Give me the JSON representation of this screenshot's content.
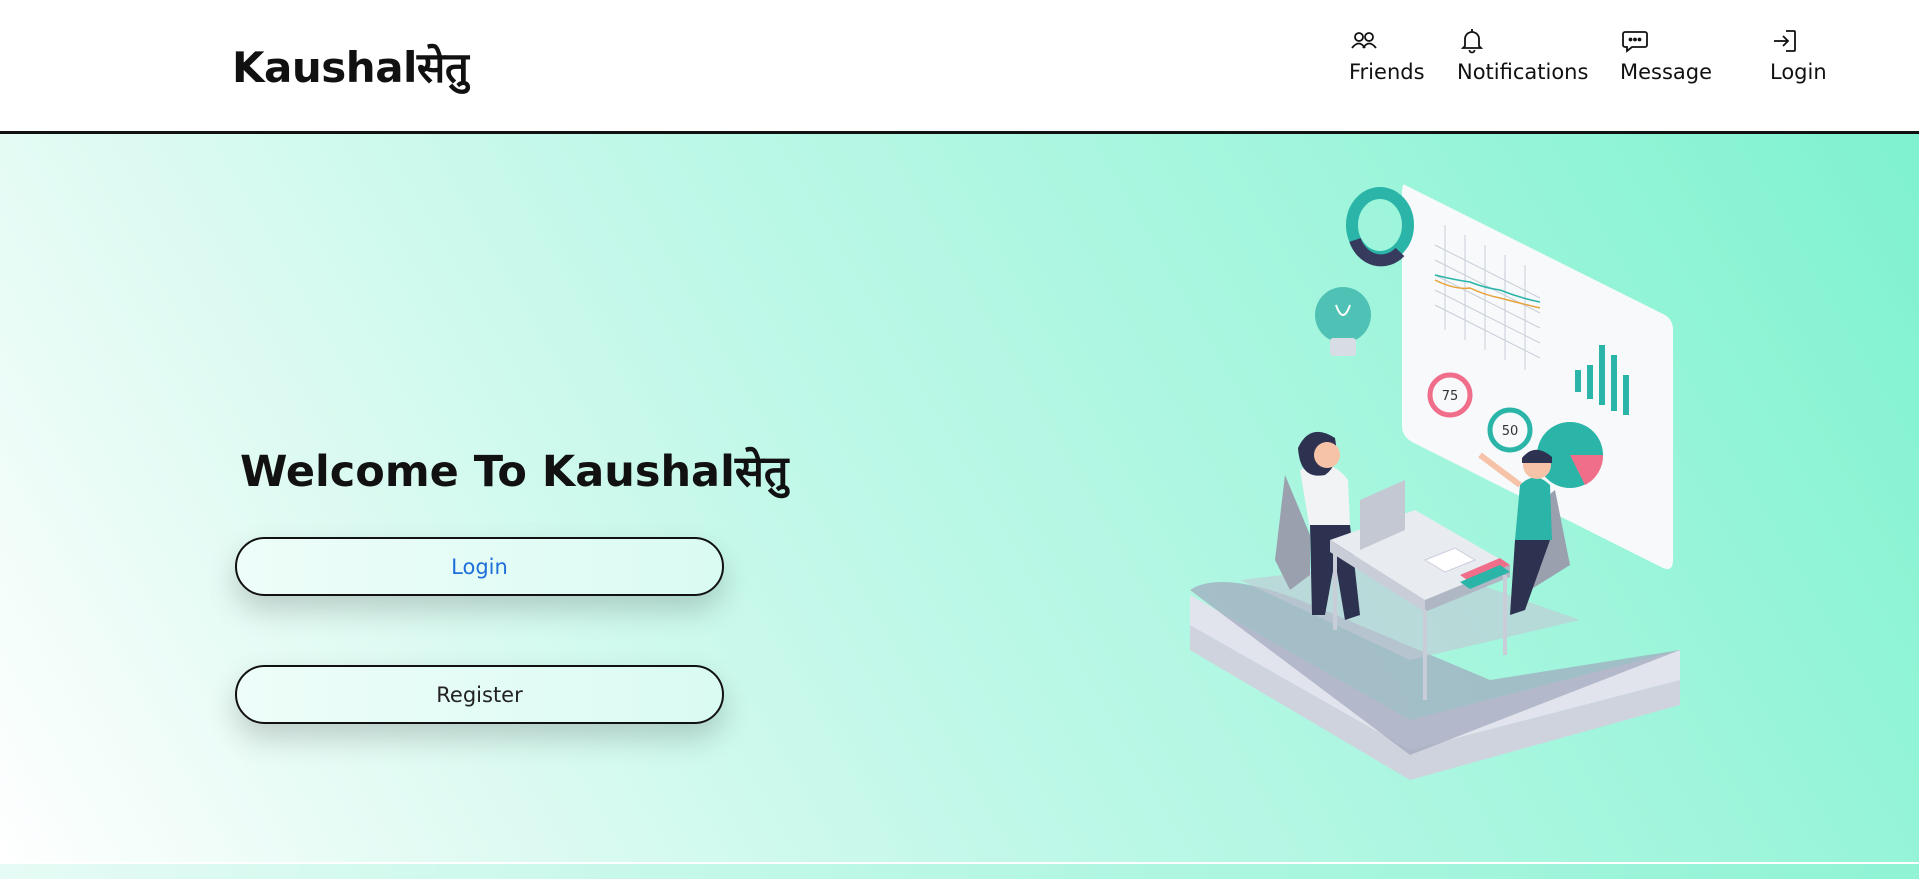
{
  "navbar": {
    "brand": "Kaushalसेतु",
    "items": [
      {
        "label": "Friends",
        "icon": "friends-icon"
      },
      {
        "label": "Notifications",
        "icon": "bell-icon"
      },
      {
        "label": "Message",
        "icon": "message-icon"
      },
      {
        "label": "Login",
        "icon": "login-icon"
      }
    ]
  },
  "hero": {
    "title": "Welcome To Kaushalसेतु",
    "login_button": "Login",
    "register_button": "Register",
    "illustration": {
      "gauge_left": "75",
      "gauge_right": "50"
    }
  },
  "colors": {
    "accent_link": "#1e6fd9",
    "hero_gradient_start": "#ffffff",
    "hero_gradient_end": "#7ff2cf",
    "teal": "#2ab5a8",
    "pink": "#f06e8a"
  }
}
